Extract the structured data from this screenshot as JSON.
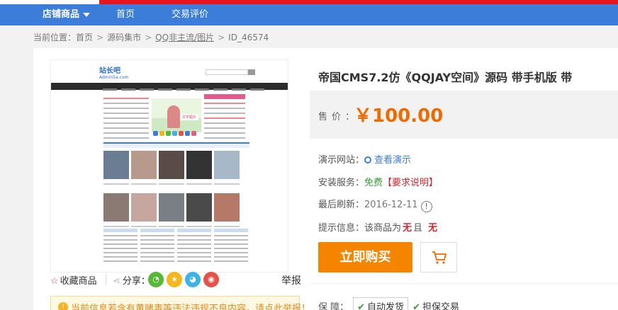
{
  "nav": {
    "shop_goods": "店铺商品",
    "home": "首页",
    "trade_review": "交易评价"
  },
  "breadcrumb": {
    "prefix": "当前位置：",
    "home": "首页",
    "market": "源码集市",
    "category": "QQ非主流/图片",
    "id": "ID_46574"
  },
  "preview": {
    "site_logo": "站长吧",
    "site_url": "Admin5a.com",
    "featured_tag": "文字图片"
  },
  "actions": {
    "favorite": "收藏商品",
    "share": "分享：",
    "report": "举报"
  },
  "notice": {
    "icon": "!",
    "text": "当前信息若含有黄赌毒等违法违规不良内容，请点此举报！"
  },
  "product": {
    "title": "帝国CMS7.2仿《QQJAY空间》源码 带手机版 带",
    "price_label": "售价：",
    "price": "￥100.00",
    "demo_label": "演示网站：",
    "demo_link": "查看演示",
    "install_label": "安装服务：",
    "install_free": "免费",
    "install_req": "【要求说明】",
    "refresh_label": "最后刷新：",
    "refresh_date": "2016-12-11",
    "tip_label": "提示信息：",
    "tip_text_1": "该商品为",
    "tip_no_1": "无",
    "tip_text_2": "且",
    "tip_no_2": "无",
    "buy_now": "立即购买",
    "guarantee_label": "保 障：",
    "auto_ship": "自动发货",
    "escrow": "担保交易"
  },
  "colors": {
    "nav_blue": "#3b7dd8",
    "price_orange": "#f06a00",
    "buy_orange": "#f58400",
    "banner_red": "#e8141e"
  }
}
